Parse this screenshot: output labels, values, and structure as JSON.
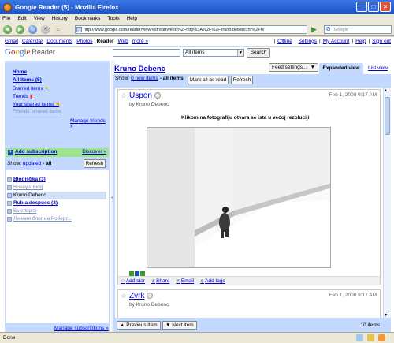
{
  "window": {
    "title": "Google Reader (5) - Mozilla Firefox"
  },
  "menu": [
    "File",
    "Edit",
    "View",
    "History",
    "Bookmarks",
    "Tools",
    "Help"
  ],
  "navbar": {
    "url": "http://www.google.com/reader/view/#stream/feed%2Fhttp%3A%2F%2Fkruno.debenc.hr%2Ffe",
    "search_placeholder": "Google"
  },
  "gbar": {
    "links": [
      "Gmail",
      "Calendar",
      "Documents",
      "Photos"
    ],
    "current": "Reader",
    "links2": [
      "Web",
      "more »"
    ],
    "user_links": [
      "Offline",
      "Settings",
      "My Account",
      "Help",
      "Sign out"
    ]
  },
  "header": {
    "logo_google": "Google",
    "logo_reader": "Reader",
    "filter": "All items",
    "search_button": "Search"
  },
  "sidebar": {
    "home": "Home",
    "all_items": "All items (5)",
    "starred": "Starred items",
    "trends": "Trends",
    "shared": "Your shared items",
    "friends": "Friends' shared items",
    "manage_friends": "Manage friends »",
    "add_subscription": "Add subscription",
    "discover": "Discover »",
    "show_prefix": "Show:",
    "show_updated": "updated",
    "show_all": "- all",
    "refresh": "Refresh",
    "subscriptions": [
      {
        "label": "Blogistika (3)",
        "style": "bold"
      },
      {
        "label": "Bokey's Blog",
        "style": "gray"
      },
      {
        "label": "Kruno Debenc",
        "style": "selected"
      },
      {
        "label": "Rubia.despues (2)",
        "style": "bold"
      },
      {
        "label": "Svjetlopisi",
        "style": "gray"
      },
      {
        "label": "Личния блог на Роберт...",
        "style": "gray"
      }
    ],
    "manage_subscriptions": "Manage subscriptions »"
  },
  "main": {
    "feed_title": "Kruno Debenc",
    "feed_settings": "Feed settings...",
    "tab_expanded": "Expanded view",
    "tab_list": "List view",
    "show_label": "Show:",
    "new_items": "0 new items",
    "all_items": "- all items",
    "mark_all_read": "Mark all as read",
    "refresh": "Refresh",
    "entries": [
      {
        "title": "Uspon",
        "date": "Feb 1, 2008 9:17 AM",
        "author": "by Kruno Debenc",
        "body": "Klikom na fotografiju otvara se ista u većoj rezoluciji",
        "actions": [
          "Add star",
          "Share",
          "Email",
          "Add tags"
        ]
      },
      {
        "title": "Zvrk",
        "date": "Feb 1, 2008 9:17 AM",
        "author": "by Kruno Debenc"
      }
    ],
    "previous_item": "Previous item",
    "next_item": "Next item",
    "item_count": "10 items"
  },
  "status": {
    "text": "Done"
  }
}
